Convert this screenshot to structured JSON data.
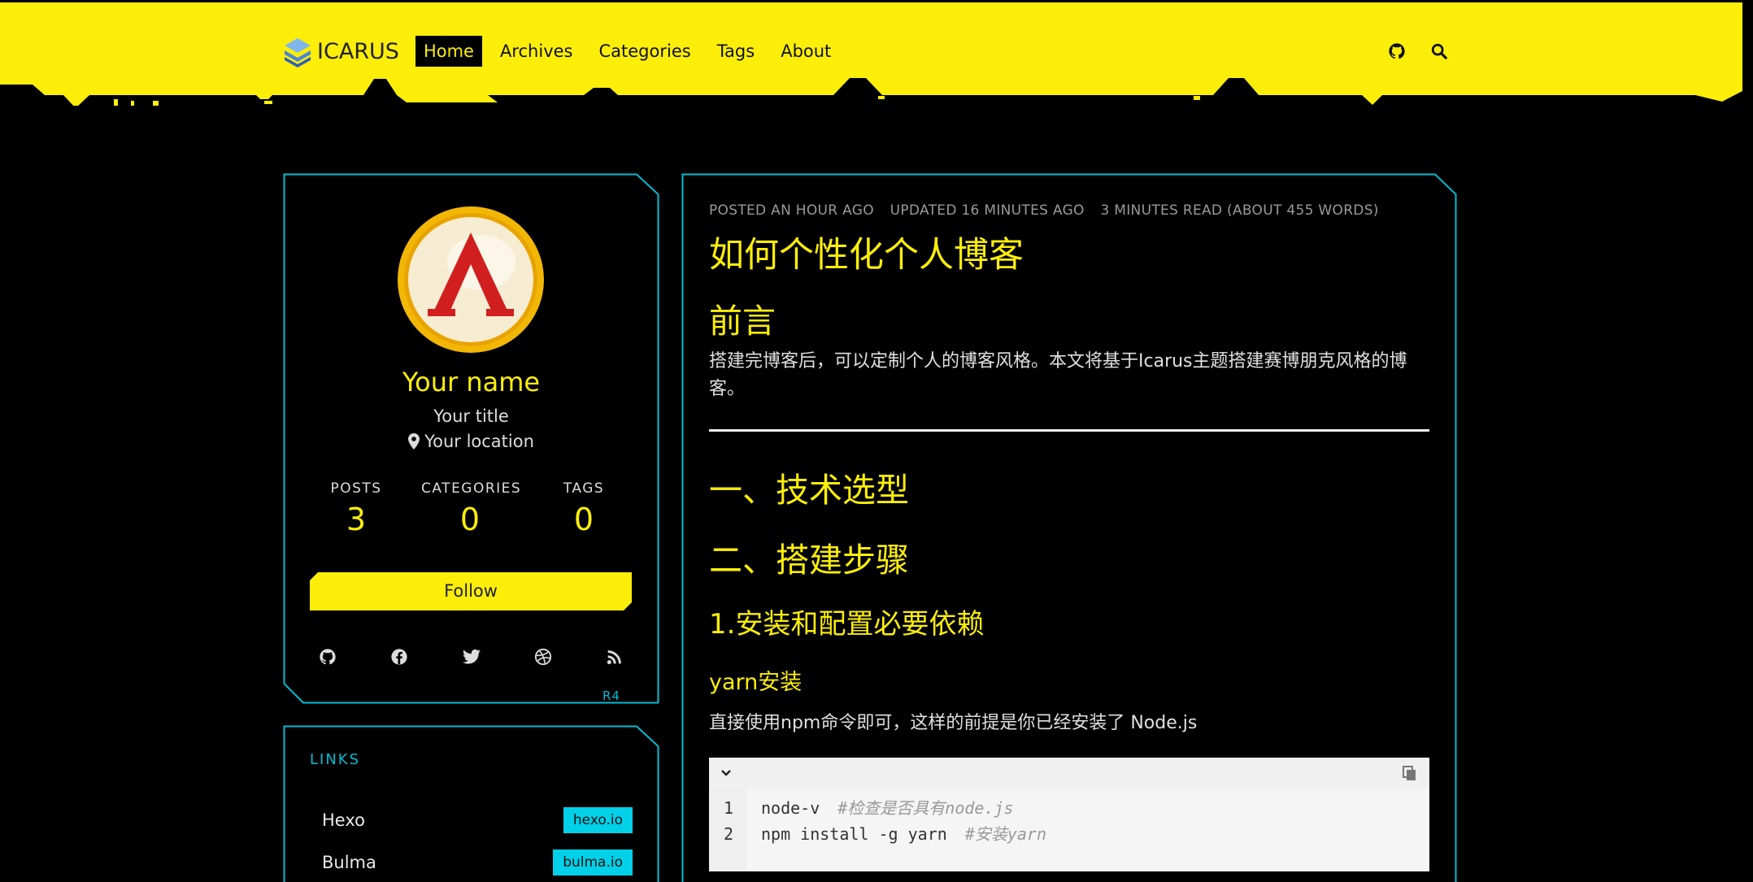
{
  "navbar": {
    "brand": "ICARUS",
    "items": [
      {
        "label": "Home",
        "active": true
      },
      {
        "label": "Archives",
        "active": false
      },
      {
        "label": "Categories",
        "active": false
      },
      {
        "label": "Tags",
        "active": false
      },
      {
        "label": "About",
        "active": false
      }
    ],
    "right_icons": [
      "github-icon",
      "search-icon"
    ]
  },
  "profile": {
    "name": "Your name",
    "title": "Your title",
    "location": "Your location",
    "levels": [
      {
        "heading": "POSTS",
        "value": "3"
      },
      {
        "heading": "CATEGORIES",
        "value": "0"
      },
      {
        "heading": "TAGS",
        "value": "0"
      }
    ],
    "follow_label": "Follow",
    "socials": [
      "github-icon",
      "facebook-icon",
      "twitter-icon",
      "dribbble-icon",
      "rss-icon"
    ],
    "corner_tag": "R4"
  },
  "links": {
    "heading": "LINKS",
    "items": [
      {
        "name": "Hexo",
        "url_label": "hexo.io"
      },
      {
        "name": "Bulma",
        "url_label": "bulma.io"
      }
    ]
  },
  "article": {
    "meta": {
      "posted": "POSTED AN HOUR AGO",
      "updated": "UPDATED 16 MINUTES AGO",
      "read": "3 MINUTES READ (ABOUT 455 WORDS)"
    },
    "title": "如何个性化个人博客",
    "intro_heading": "前言",
    "intro_text": "搭建完博客后，可以定制个人的博客风格。本文将基于Icarus主题搭建赛博朋克风格的博客。",
    "h2_1": "一、技术选型",
    "h2_2": "二、搭建步骤",
    "h3_1": "1.安装和配置必要依赖",
    "h4_1": "yarn安装",
    "yarn_text": "直接使用npm命令即可，这样的前提是你已经安装了 Node.js",
    "code": [
      {
        "num": "1",
        "code": "node-v",
        "comment": "#检查是否具有node.js"
      },
      {
        "num": "2",
        "code": "npm install -g yarn",
        "comment": "#安装yarn"
      }
    ]
  },
  "colors": {
    "accent_yellow": "#fcee09",
    "accent_cyan": "#00bcd4",
    "background": "#000000"
  }
}
